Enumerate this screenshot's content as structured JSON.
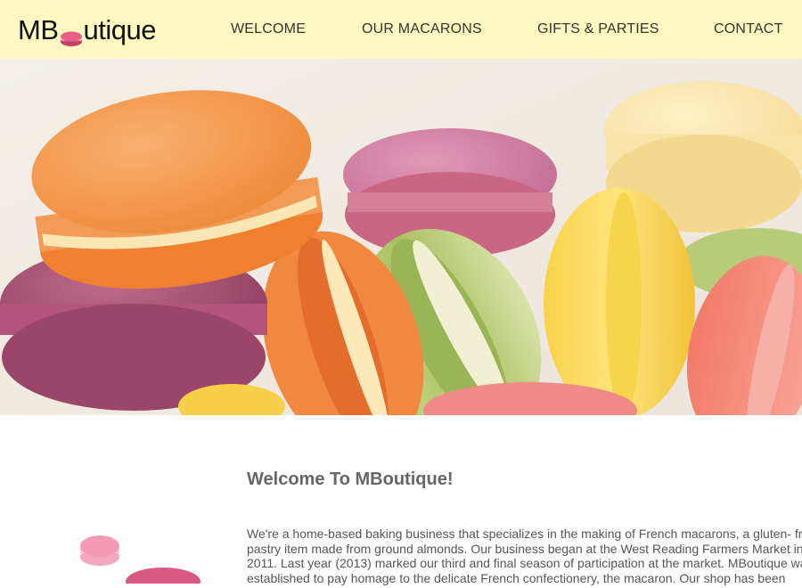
{
  "brand": {
    "logo_prefix": "MB",
    "logo_suffix": "utique",
    "accent_color": "#e8608a",
    "header_bg": "#fef9c0"
  },
  "nav": {
    "items": [
      {
        "label": "WELCOME"
      },
      {
        "label": "OUR MACARONS"
      },
      {
        "label": "GIFTS & PARTIES"
      },
      {
        "label": "CONTACT"
      }
    ]
  },
  "hero": {
    "subject": "macarons-photo"
  },
  "main": {
    "title": "Welcome To MBoutique!",
    "intro": "We're a home-based baking business that specializes in the making of French macarons, a gluten- free\npastry item made from ground almonds. Our business began at the West Reading Farmers Market in\n2011. Last year (2013) marked our third and final season of participation at the market. MBoutique was\nestablished to pay homage to the delicate French confectionery, the macaron. Our shop has been"
  }
}
